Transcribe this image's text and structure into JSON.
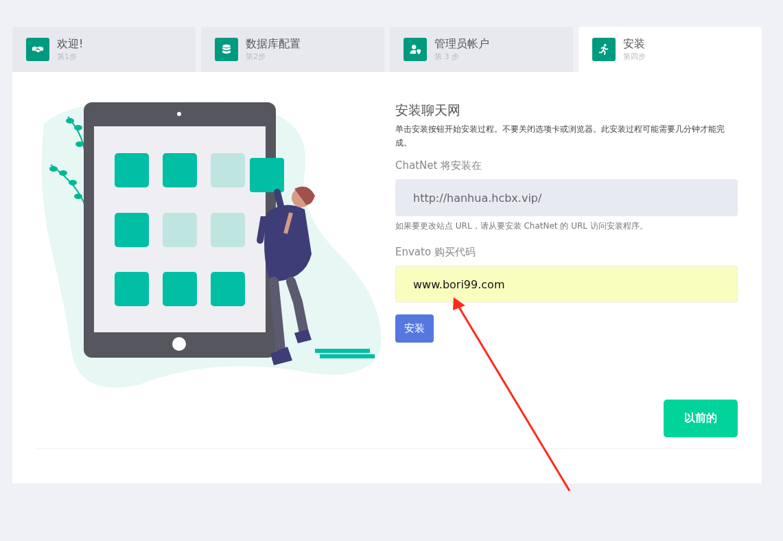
{
  "tabs": [
    {
      "kind": "handshake",
      "label": "欢迎!",
      "step": "第1步",
      "selected": false
    },
    {
      "kind": "database",
      "label": "数据库配置",
      "step": "第2步",
      "selected": false
    },
    {
      "kind": "user-shield",
      "label": "管理员帐户",
      "step": "第 3 步",
      "selected": false
    },
    {
      "kind": "runner",
      "label": "安装",
      "step": "第四步",
      "selected": true
    }
  ],
  "install": {
    "title": "安装聊天网",
    "description": "单击安装按钮开始安装过程。不要关闭选项卡或浏览器。此安装过程可能需要几分钟才能完成。",
    "url_label": "ChatNet 将安装在",
    "url_value": "http://hanhua.hcbx.vip/",
    "url_help": "如果要更改站点 URL，请从要安装 ChatNet 的 URL 访问安装程序。",
    "code_label": "Envato 购买代码",
    "code_value": "www.bori99.com",
    "install_button": "安装"
  },
  "previous_button": "以前的"
}
